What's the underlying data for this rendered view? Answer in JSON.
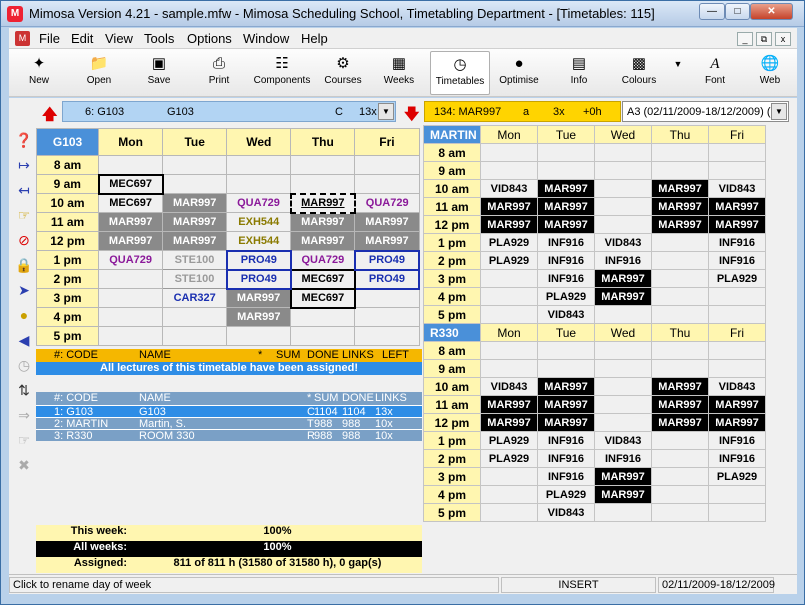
{
  "window": {
    "title": "Mimosa Version 4.21 - sample.mfw - Mimosa Scheduling School, Timetabling Department - [Timetables: 115]"
  },
  "menu": [
    "File",
    "Edit",
    "View",
    "Tools",
    "Options",
    "Window",
    "Help"
  ],
  "toolbar": [
    {
      "label": "New",
      "icon": "new-icon"
    },
    {
      "label": "Open",
      "icon": "open-icon"
    },
    {
      "label": "Save",
      "icon": "save-icon"
    },
    {
      "label": "Print",
      "icon": "print-icon"
    },
    {
      "label": "Components",
      "icon": "components-icon"
    },
    {
      "label": "Courses",
      "icon": "courses-icon"
    },
    {
      "label": "Weeks",
      "icon": "weeks-icon"
    },
    {
      "label": "Timetables",
      "icon": "timetables-icon"
    },
    {
      "label": "Optimise",
      "icon": "optimise-icon"
    },
    {
      "label": "Info",
      "icon": "info-icon"
    },
    {
      "label": "Colours",
      "icon": "colours-icon"
    },
    {
      "label": "Font",
      "icon": "font-icon"
    },
    {
      "label": "Web",
      "icon": "web-icon"
    }
  ],
  "left_selector": {
    "num": "6: G103",
    "name": "G103",
    "type": "C",
    "links": "13x"
  },
  "right_selector": {
    "code": "134: MAR997",
    "flag": "a",
    "count": "3x",
    "plus": "+0h",
    "week": "A3 (02/11/2009-18/12/2009) ("
  },
  "main_grid": {
    "corner": "G103",
    "days": [
      "Mon",
      "Tue",
      "Wed",
      "Thu",
      "Fri"
    ],
    "times": [
      "8 am",
      "9 am",
      "10 am",
      "11 am",
      "12 pm",
      "1 pm",
      "2 pm",
      "3 pm",
      "4 pm",
      "5 pm"
    ],
    "cells": [
      [
        {
          "t": "",
          "s": ""
        },
        {
          "t": "",
          "s": ""
        },
        {
          "t": "",
          "s": ""
        },
        {
          "t": "",
          "s": ""
        },
        {
          "t": "",
          "s": ""
        }
      ],
      [
        {
          "t": "MEC697",
          "s": "c-boxed"
        },
        {
          "t": "",
          "s": ""
        },
        {
          "t": "",
          "s": ""
        },
        {
          "t": "",
          "s": ""
        },
        {
          "t": "",
          "s": ""
        }
      ],
      [
        {
          "t": "MEC697",
          "s": ""
        },
        {
          "t": "MAR997",
          "s": "c-gray"
        },
        {
          "t": "QUA729",
          "s": "c-purple"
        },
        {
          "t": "MAR997",
          "s": "c-dashed"
        },
        {
          "t": "QUA729",
          "s": "c-purple"
        }
      ],
      [
        {
          "t": "MAR997",
          "s": "c-gray"
        },
        {
          "t": "MAR997",
          "s": "c-gray"
        },
        {
          "t": "EXH544",
          "s": "c-olive"
        },
        {
          "t": "MAR997",
          "s": "c-gray"
        },
        {
          "t": "MAR997",
          "s": "c-gray"
        }
      ],
      [
        {
          "t": "MAR997",
          "s": "c-gray"
        },
        {
          "t": "MAR997",
          "s": "c-gray"
        },
        {
          "t": "EXH544",
          "s": "c-olive"
        },
        {
          "t": "MAR997",
          "s": "c-gray"
        },
        {
          "t": "MAR997",
          "s": "c-gray"
        }
      ],
      [
        {
          "t": "QUA729",
          "s": "c-purple"
        },
        {
          "t": "STE100",
          "s": "c-light"
        },
        {
          "t": "PRO49",
          "s": "c-blue c-bbox"
        },
        {
          "t": "QUA729",
          "s": "c-purple"
        },
        {
          "t": "PRO49",
          "s": "c-blue c-bbox"
        }
      ],
      [
        {
          "t": "",
          "s": ""
        },
        {
          "t": "STE100",
          "s": "c-light"
        },
        {
          "t": "PRO49",
          "s": "c-blue c-bbox"
        },
        {
          "t": "MEC697",
          "s": "c-boxed"
        },
        {
          "t": "PRO49",
          "s": "c-blue c-bbox"
        }
      ],
      [
        {
          "t": "",
          "s": ""
        },
        {
          "t": "CAR327",
          "s": "c-blue"
        },
        {
          "t": "MAR997",
          "s": "c-gray"
        },
        {
          "t": "MEC697",
          "s": "c-boxed"
        },
        {
          "t": "",
          "s": ""
        }
      ],
      [
        {
          "t": "",
          "s": ""
        },
        {
          "t": "",
          "s": ""
        },
        {
          "t": "MAR997",
          "s": "c-gray"
        },
        {
          "t": "",
          "s": ""
        },
        {
          "t": "",
          "s": ""
        }
      ],
      [
        {
          "t": "",
          "s": ""
        },
        {
          "t": "",
          "s": ""
        },
        {
          "t": "",
          "s": ""
        },
        {
          "t": "",
          "s": ""
        },
        {
          "t": "",
          "s": ""
        }
      ]
    ]
  },
  "lecture_bar": {
    "code": "#: CODE",
    "name": "NAME",
    "star": "*",
    "sum": "SUM",
    "done": "DONE",
    "links": "LINKS",
    "left": "LEFT",
    "message": "All lectures of this timetable have been assigned!"
  },
  "components": {
    "headers": {
      "code": "#: CODE",
      "name": "NAME",
      "star": "*",
      "sum": "SUM",
      "done": "DONE",
      "links": "LINKS"
    },
    "rows": [
      {
        "code": "1: G103",
        "name": "G103",
        "star": "C",
        "sum": "1104",
        "done": "1104",
        "links": "13x"
      },
      {
        "code": "2: MARTIN",
        "name": "Martin, S.",
        "star": "T",
        "sum": "988",
        "done": "988",
        "links": "10x"
      },
      {
        "code": "3: R330",
        "name": "ROOM 330",
        "star": "R",
        "sum": "988",
        "done": "988",
        "links": "10x"
      }
    ]
  },
  "stats": [
    {
      "label": "This week:",
      "value": "100%"
    },
    {
      "label": "All weeks:",
      "value": "100%"
    },
    {
      "label": "Assigned:",
      "value": "811 of 811 h (31580 of 31580 h), 0 gap(s)"
    }
  ],
  "right_grids": [
    {
      "name": "MARTIN",
      "days": [
        "Mon",
        "Tue",
        "Wed",
        "Thu",
        "Fri"
      ],
      "times": [
        "8 am",
        "9 am",
        "10 am",
        "11 am",
        "12 pm",
        "1 pm",
        "2 pm",
        "3 pm",
        "4 pm",
        "5 pm"
      ],
      "cells": [
        [
          "",
          "",
          "",
          "",
          ""
        ],
        [
          "",
          "",
          "",
          "",
          ""
        ],
        [
          "VID843",
          "*MAR997",
          "",
          "*MAR997",
          "VID843"
        ],
        [
          "*MAR997",
          "*MAR997",
          "",
          "*MAR997",
          "*MAR997"
        ],
        [
          "*MAR997",
          "*MAR997",
          "",
          "*MAR997",
          "*MAR997"
        ],
        [
          "PLA929",
          "INF916",
          "VID843",
          "",
          "INF916"
        ],
        [
          "PLA929",
          "INF916",
          "INF916",
          "",
          "INF916"
        ],
        [
          "",
          "INF916",
          "*MAR997",
          "",
          "PLA929"
        ],
        [
          "",
          "PLA929",
          "*MAR997",
          "",
          ""
        ],
        [
          "",
          "VID843",
          "",
          "",
          ""
        ]
      ]
    },
    {
      "name": "R330",
      "days": [
        "Mon",
        "Tue",
        "Wed",
        "Thu",
        "Fri"
      ],
      "times": [
        "8 am",
        "9 am",
        "10 am",
        "11 am",
        "12 pm",
        "1 pm",
        "2 pm",
        "3 pm",
        "4 pm",
        "5 pm"
      ],
      "cells": [
        [
          "",
          "",
          "",
          "",
          ""
        ],
        [
          "",
          "",
          "",
          "",
          ""
        ],
        [
          "VID843",
          "*MAR997",
          "",
          "*MAR997",
          "VID843"
        ],
        [
          "*MAR997",
          "*MAR997",
          "",
          "*MAR997",
          "*MAR997"
        ],
        [
          "*MAR997",
          "*MAR997",
          "",
          "*MAR997",
          "*MAR997"
        ],
        [
          "PLA929",
          "INF916",
          "VID843",
          "",
          "INF916"
        ],
        [
          "PLA929",
          "INF916",
          "INF916",
          "",
          "INF916"
        ],
        [
          "",
          "INF916",
          "*MAR997",
          "",
          "PLA929"
        ],
        [
          "",
          "PLA929",
          "*MAR997",
          "",
          ""
        ],
        [
          "",
          "VID843",
          "",
          "",
          ""
        ]
      ]
    }
  ],
  "status": {
    "hint": "Click to rename day of week",
    "mode": "INSERT",
    "range": "02/11/2009-18/12/2009"
  }
}
